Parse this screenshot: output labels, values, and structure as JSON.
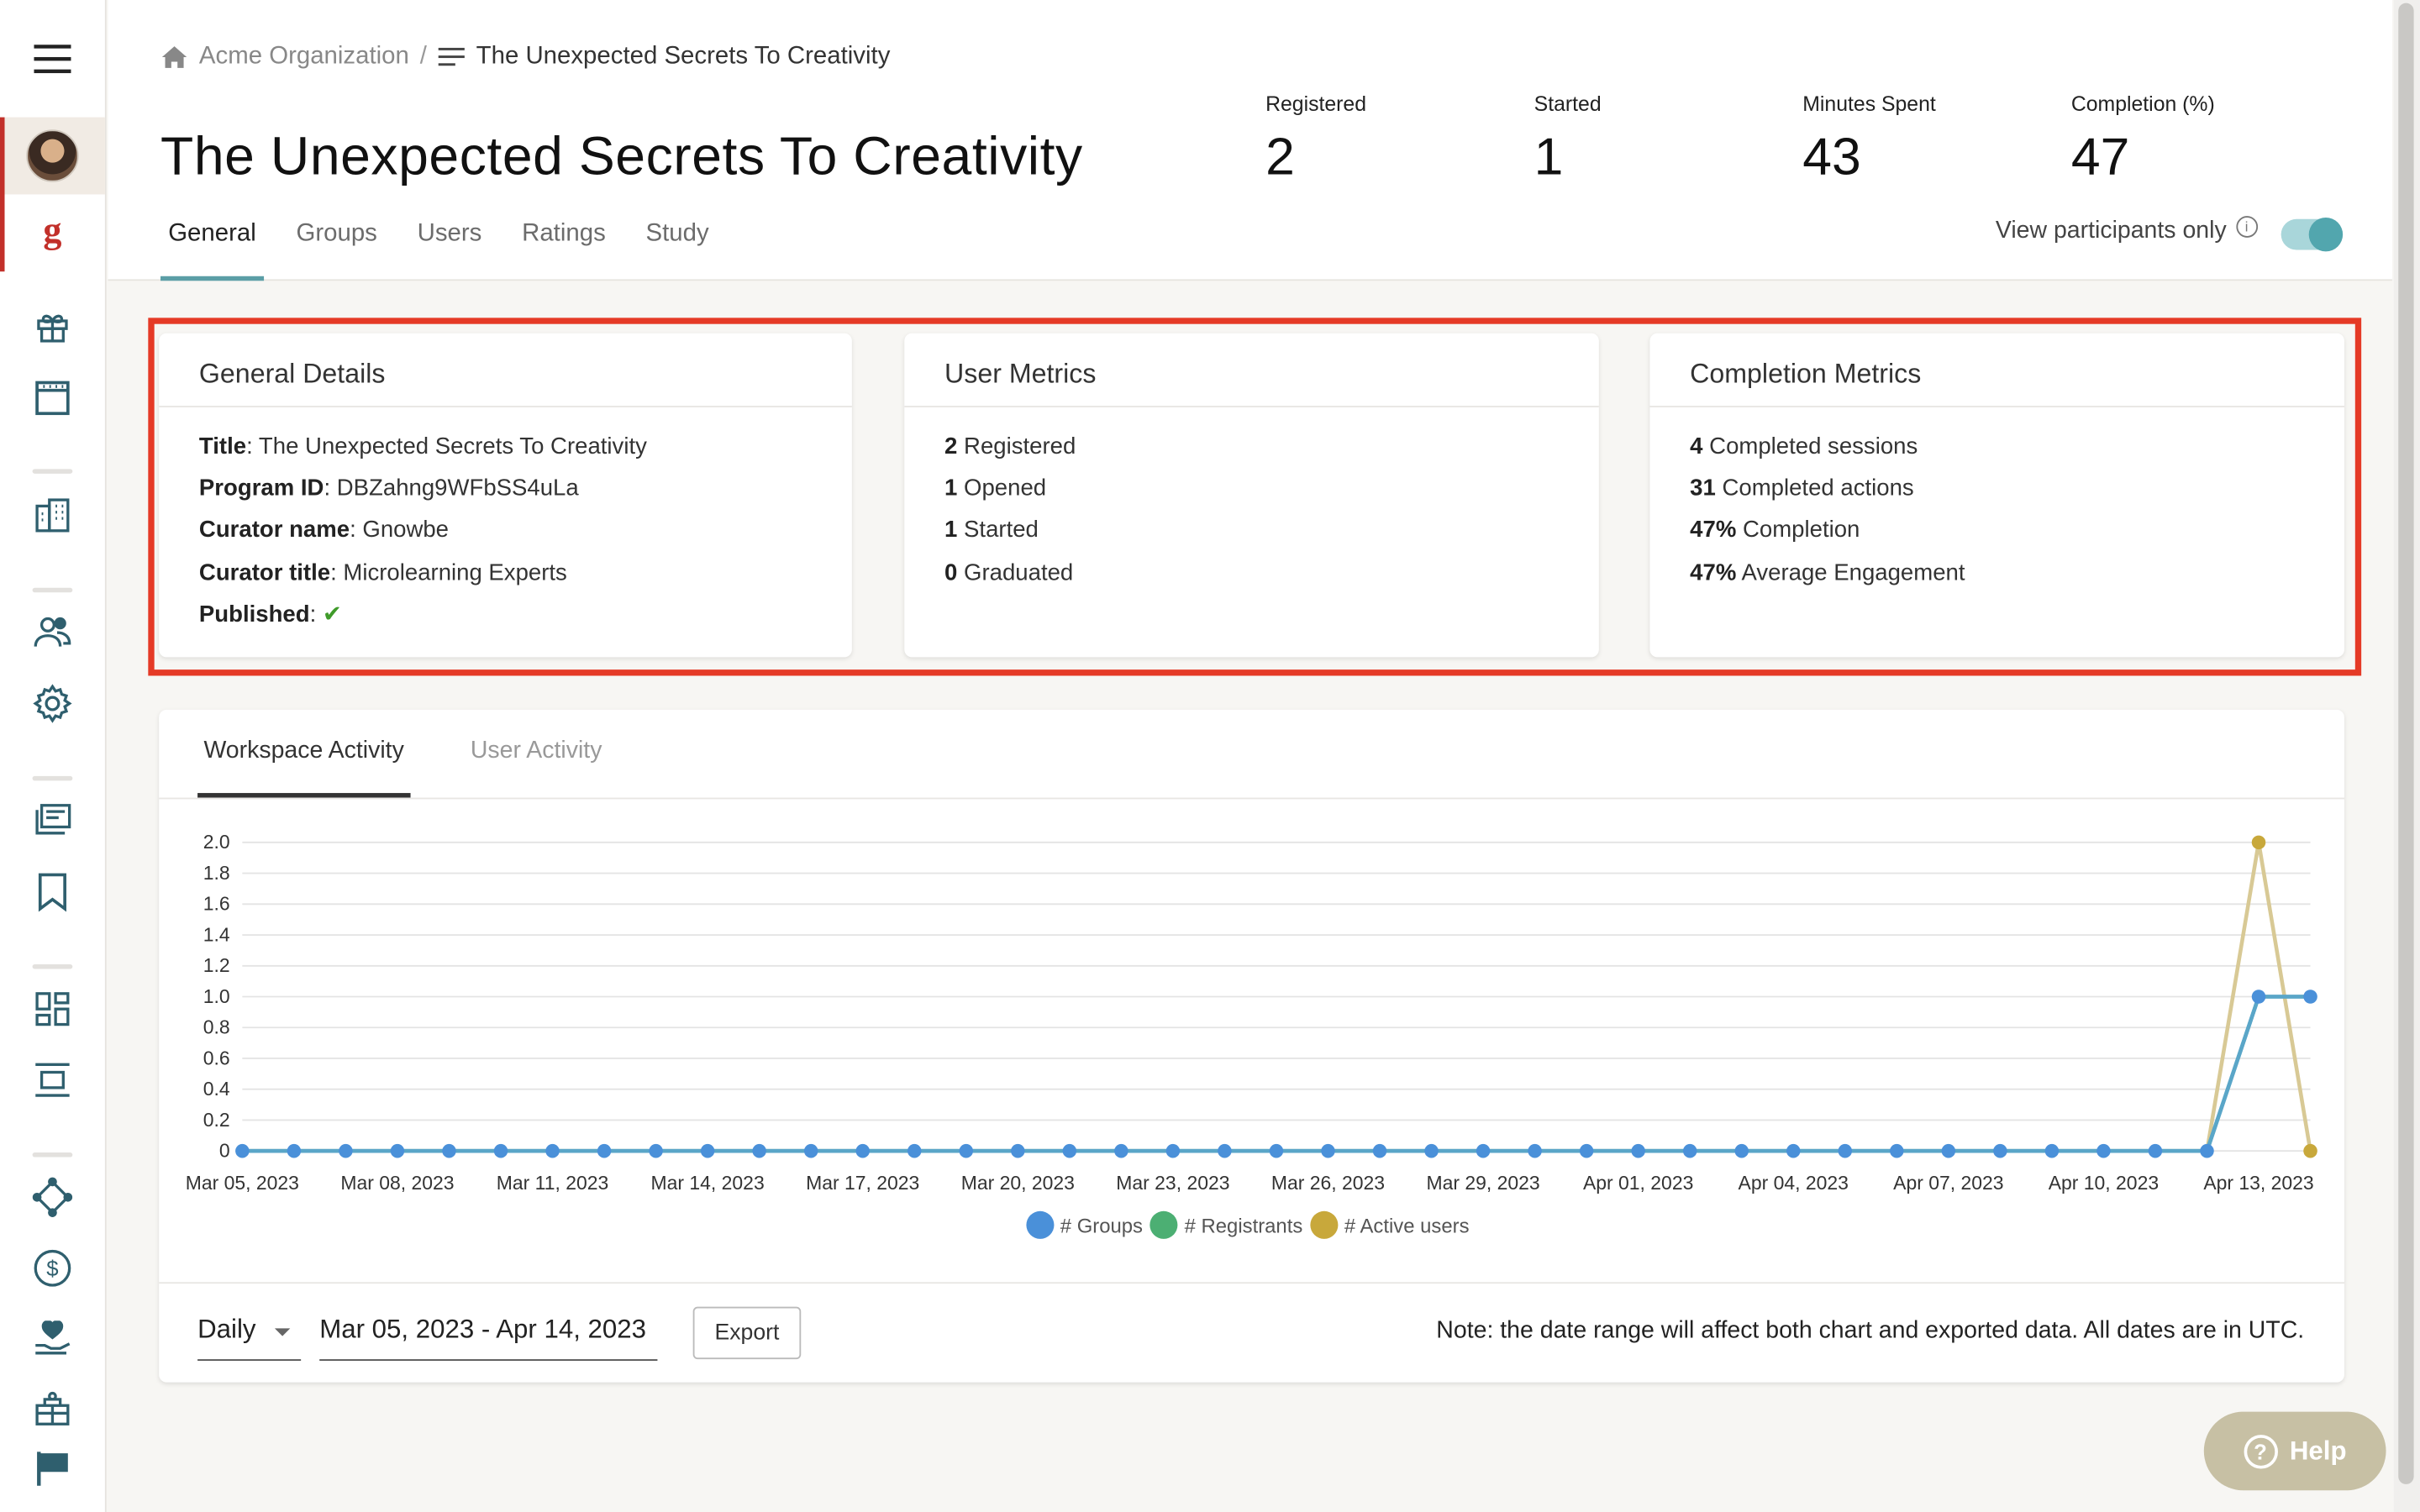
{
  "breadcrumb": {
    "org": "Acme Organization",
    "separator": "/",
    "current": "The Unexpected Secrets To Creativity"
  },
  "page_title": "The Unexpected Secrets To Creativity",
  "stats": [
    {
      "label": "Registered",
      "value": "2"
    },
    {
      "label": "Started",
      "value": "1"
    },
    {
      "label": "Minutes Spent",
      "value": "43"
    },
    {
      "label": "Completion (%)",
      "value": "47"
    }
  ],
  "tabs": [
    "General",
    "Groups",
    "Users",
    "Ratings",
    "Study"
  ],
  "active_tab": "General",
  "view_participants": {
    "label": "View participants only",
    "enabled": true
  },
  "general_details": {
    "title": "General Details",
    "rows": [
      {
        "key": "Title",
        "value": "The Unexpected Secrets To Creativity"
      },
      {
        "key": "Program ID",
        "value": "DBZahng9WFbSS4uLa"
      },
      {
        "key": "Curator name",
        "value": "Gnowbe"
      },
      {
        "key": "Curator title",
        "value": "Microlearning Experts"
      },
      {
        "key": "Published",
        "value": "✔"
      }
    ]
  },
  "user_metrics": {
    "title": "User Metrics",
    "rows": [
      {
        "num": "2",
        "label": "Registered"
      },
      {
        "num": "1",
        "label": "Opened"
      },
      {
        "num": "1",
        "label": "Started"
      },
      {
        "num": "0",
        "label": "Graduated"
      }
    ]
  },
  "completion_metrics": {
    "title": "Completion Metrics",
    "rows": [
      {
        "num": "4",
        "label": "Completed sessions"
      },
      {
        "num": "31",
        "label": "Completed actions"
      },
      {
        "num": "47%",
        "label": "Completion"
      },
      {
        "num": "47%",
        "label": "Average Engagement"
      }
    ]
  },
  "activity_tabs": [
    "Workspace Activity",
    "User Activity"
  ],
  "active_activity_tab": "Workspace Activity",
  "chart_data": {
    "type": "line",
    "title": "",
    "xlabel": "",
    "ylabel": "",
    "ylim": [
      0,
      2.0
    ],
    "yticks": [
      "0",
      "0.2",
      "0.4",
      "0.6",
      "0.8",
      "1.0",
      "1.2",
      "1.4",
      "1.6",
      "1.8",
      "2.0"
    ],
    "x_tick_labels": [
      "Mar 05, 2023",
      "Mar 08, 2023",
      "Mar 11, 2023",
      "Mar 14, 2023",
      "Mar 17, 2023",
      "Mar 20, 2023",
      "Mar 23, 2023",
      "Mar 26, 2023",
      "Mar 29, 2023",
      "Apr 01, 2023",
      "Apr 04, 2023",
      "Apr 07, 2023",
      "Apr 10, 2023",
      "Apr 13, 2023"
    ],
    "x_start": "2023-03-05",
    "x_end": "2023-04-14",
    "grid": true,
    "legend": "bottom",
    "series": [
      {
        "name": "# Groups",
        "color": "#4a90d9",
        "values": [
          0,
          0,
          0,
          0,
          0,
          0,
          0,
          0,
          0,
          0,
          0,
          0,
          0,
          0,
          0,
          0,
          0,
          0,
          0,
          0,
          0,
          0,
          0,
          0,
          0,
          0,
          0,
          0,
          0,
          0,
          0,
          0,
          0,
          0,
          0,
          0,
          0,
          0,
          0,
          1,
          1
        ]
      },
      {
        "name": "# Registrants",
        "color": "#4caf73",
        "values": [
          0,
          0,
          0,
          0,
          0,
          0,
          0,
          0,
          0,
          0,
          0,
          0,
          0,
          0,
          0,
          0,
          0,
          0,
          0,
          0,
          0,
          0,
          0,
          0,
          0,
          0,
          0,
          0,
          0,
          0,
          0,
          0,
          0,
          0,
          0,
          0,
          0,
          0,
          0,
          1,
          1
        ]
      },
      {
        "name": "# Active users",
        "color": "#c8a83b",
        "values": [
          0,
          0,
          0,
          0,
          0,
          0,
          0,
          0,
          0,
          0,
          0,
          0,
          0,
          0,
          0,
          0,
          0,
          0,
          0,
          0,
          0,
          0,
          0,
          0,
          0,
          0,
          0,
          0,
          0,
          0,
          0,
          0,
          0,
          0,
          0,
          0,
          0,
          0,
          0,
          2,
          0
        ]
      }
    ]
  },
  "footer": {
    "period": "Daily",
    "date_range": "Mar 05, 2023 - Apr 14, 2023",
    "export_label": "Export",
    "note": "Note: the date range will affect both chart and exported data. All dates are in UTC."
  },
  "help_label": "Help",
  "colors": {
    "accent": "#5b9ea6",
    "highlight": "#e53a26",
    "brand_red": "#c2302a"
  },
  "sidebar_icons": [
    "menu-icon",
    "avatar",
    "gnowbe-logo-icon",
    "gift-icon",
    "calendar-icon",
    "building-icon",
    "users-icon",
    "gear-icon",
    "library-icon",
    "bookmark-icon",
    "dashboard-icon",
    "layout-icon",
    "integration-icon",
    "dollar-icon",
    "heart-hand-icon",
    "gift-box-icon",
    "flag-icon"
  ]
}
